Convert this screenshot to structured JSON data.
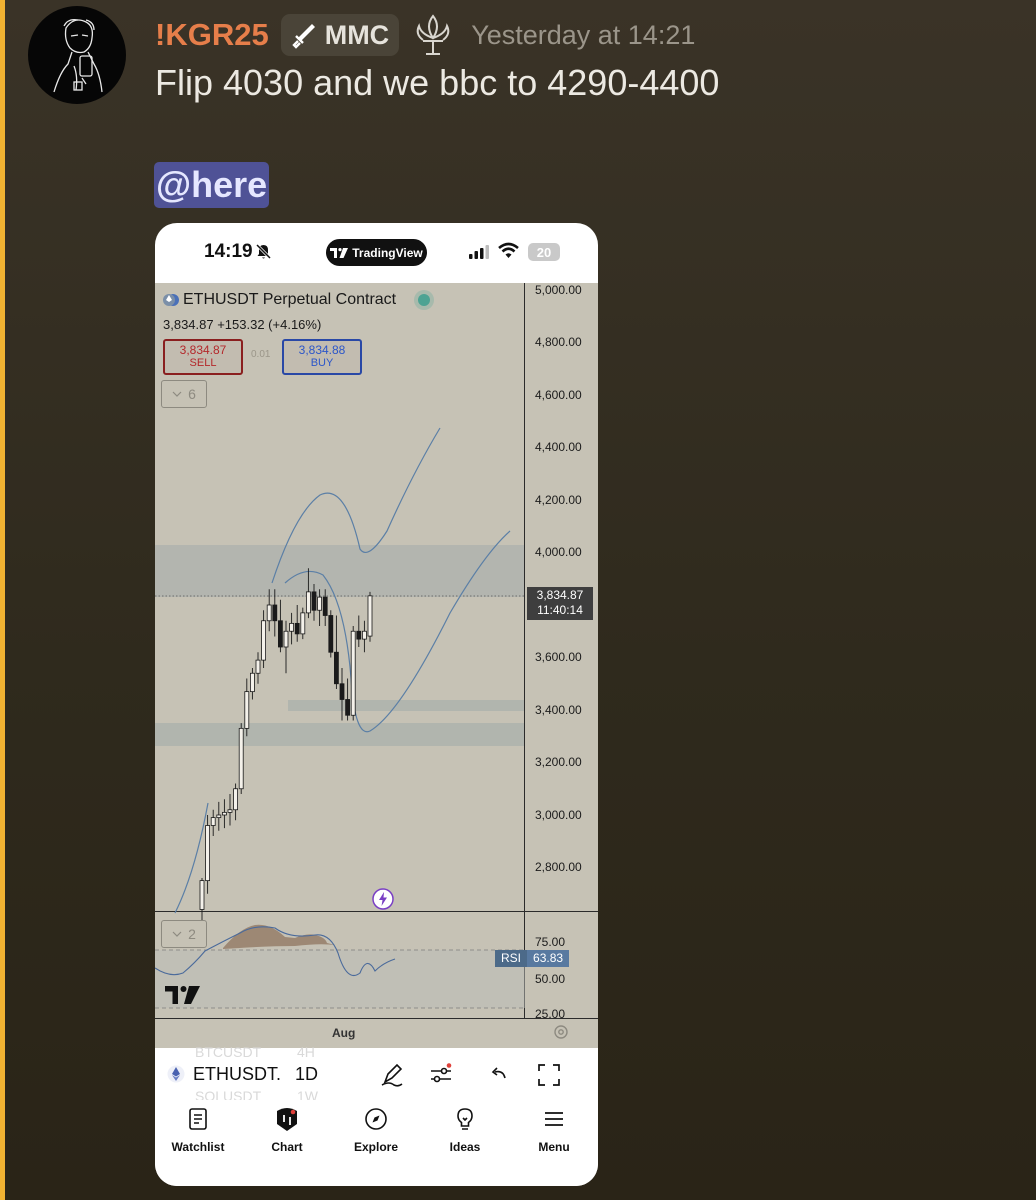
{
  "message": {
    "username": "!KGR25",
    "role_badge": "MMC",
    "timestamp": "Yesterday at 14:21",
    "text": "Flip 4030 and we bbc to 4290-4400",
    "mention": "@here",
    "colors": {
      "username": "#e67e4a",
      "mention_bg": "#4f5296",
      "accent_bar": "#f0b232"
    }
  },
  "phone": {
    "status": {
      "time": "14:19",
      "app_pill": "TradingView",
      "battery": "20"
    },
    "chart": {
      "symbol_title": "ETHUSDT Perpetual Contract",
      "quote": "3,834.87 +153.32 (+4.16%)",
      "sell_price": "3,834.87",
      "sell_label": "SELL",
      "spread": "0.01",
      "buy_price": "3,834.88",
      "buy_label": "BUY",
      "collapsed_count": "6",
      "price_ticks": [
        "5,000.00",
        "4,800.00",
        "4,600.00",
        "4,400.00",
        "4,200.00",
        "4,000.00",
        "3,600.00",
        "3,400.00",
        "3,200.00",
        "3,000.00",
        "2,800.00"
      ],
      "last_price": "3,834.87",
      "countdown": "11:40:14",
      "rsi_collapsed_count": "2",
      "rsi_label": "RSI",
      "rsi_value": "63.83",
      "rsi_ticks": [
        "75.00",
        "50.00",
        "25.00"
      ],
      "time_label": "Aug"
    },
    "symbol_bar": {
      "ghost_above": "BTCUSDT",
      "ghost_above_interval": "4H",
      "symbol": "ETHUSDT.",
      "interval": "1D",
      "ghost_below": "SOLUSDT",
      "ghost_below_interval": "1W"
    },
    "tabs": [
      "Watchlist",
      "Chart",
      "Explore",
      "Ideas",
      "Menu"
    ]
  },
  "chart_data": {
    "type": "candlestick",
    "symbol": "ETHUSDT Perpetual Contract",
    "interval": "1D",
    "ylim": [
      2600,
      5050
    ],
    "last_price": 3834.87,
    "change": 153.32,
    "change_pct": 4.16,
    "candles": [
      {
        "o": 2640,
        "h": 2760,
        "l": 2600,
        "c": 2750
      },
      {
        "o": 2750,
        "h": 3000,
        "l": 2700,
        "c": 2960
      },
      {
        "o": 2960,
        "h": 3020,
        "l": 2920,
        "c": 2990
      },
      {
        "o": 2990,
        "h": 3050,
        "l": 2940,
        "c": 3000
      },
      {
        "o": 3000,
        "h": 3060,
        "l": 2950,
        "c": 3010
      },
      {
        "o": 3010,
        "h": 3080,
        "l": 2960,
        "c": 3020
      },
      {
        "o": 3020,
        "h": 3120,
        "l": 2980,
        "c": 3100
      },
      {
        "o": 3100,
        "h": 3350,
        "l": 3080,
        "c": 3330
      },
      {
        "o": 3330,
        "h": 3520,
        "l": 3300,
        "c": 3470
      },
      {
        "o": 3470,
        "h": 3560,
        "l": 3440,
        "c": 3540
      },
      {
        "o": 3540,
        "h": 3620,
        "l": 3500,
        "c": 3590
      },
      {
        "o": 3590,
        "h": 3780,
        "l": 3560,
        "c": 3740
      },
      {
        "o": 3740,
        "h": 3860,
        "l": 3700,
        "c": 3800
      },
      {
        "o": 3800,
        "h": 3860,
        "l": 3680,
        "c": 3740
      },
      {
        "o": 3740,
        "h": 3820,
        "l": 3620,
        "c": 3640
      },
      {
        "o": 3640,
        "h": 3740,
        "l": 3540,
        "c": 3700
      },
      {
        "o": 3700,
        "h": 3770,
        "l": 3650,
        "c": 3730
      },
      {
        "o": 3730,
        "h": 3800,
        "l": 3660,
        "c": 3690
      },
      {
        "o": 3690,
        "h": 3790,
        "l": 3670,
        "c": 3770
      },
      {
        "o": 3770,
        "h": 3940,
        "l": 3750,
        "c": 3850
      },
      {
        "o": 3850,
        "h": 3880,
        "l": 3740,
        "c": 3780
      },
      {
        "o": 3780,
        "h": 3860,
        "l": 3720,
        "c": 3830
      },
      {
        "o": 3830,
        "h": 3860,
        "l": 3720,
        "c": 3760
      },
      {
        "o": 3760,
        "h": 3780,
        "l": 3600,
        "c": 3620
      },
      {
        "o": 3620,
        "h": 3760,
        "l": 3480,
        "c": 3500
      },
      {
        "o": 3500,
        "h": 3560,
        "l": 3360,
        "c": 3440
      },
      {
        "o": 3440,
        "h": 3520,
        "l": 3360,
        "c": 3380
      },
      {
        "o": 3380,
        "h": 3720,
        "l": 3360,
        "c": 3700
      },
      {
        "o": 3700,
        "h": 3760,
        "l": 3640,
        "c": 3670
      },
      {
        "o": 3670,
        "h": 3740,
        "l": 3620,
        "c": 3700
      },
      {
        "o": 3681.55,
        "h": 3850,
        "l": 3660,
        "c": 3834.87
      }
    ],
    "zones": [
      [
        3840,
        4030
      ],
      [
        3300,
        3380
      ],
      [
        3410,
        3450
      ]
    ],
    "rsi": {
      "value": 63.83,
      "levels": [
        70,
        30
      ]
    }
  }
}
